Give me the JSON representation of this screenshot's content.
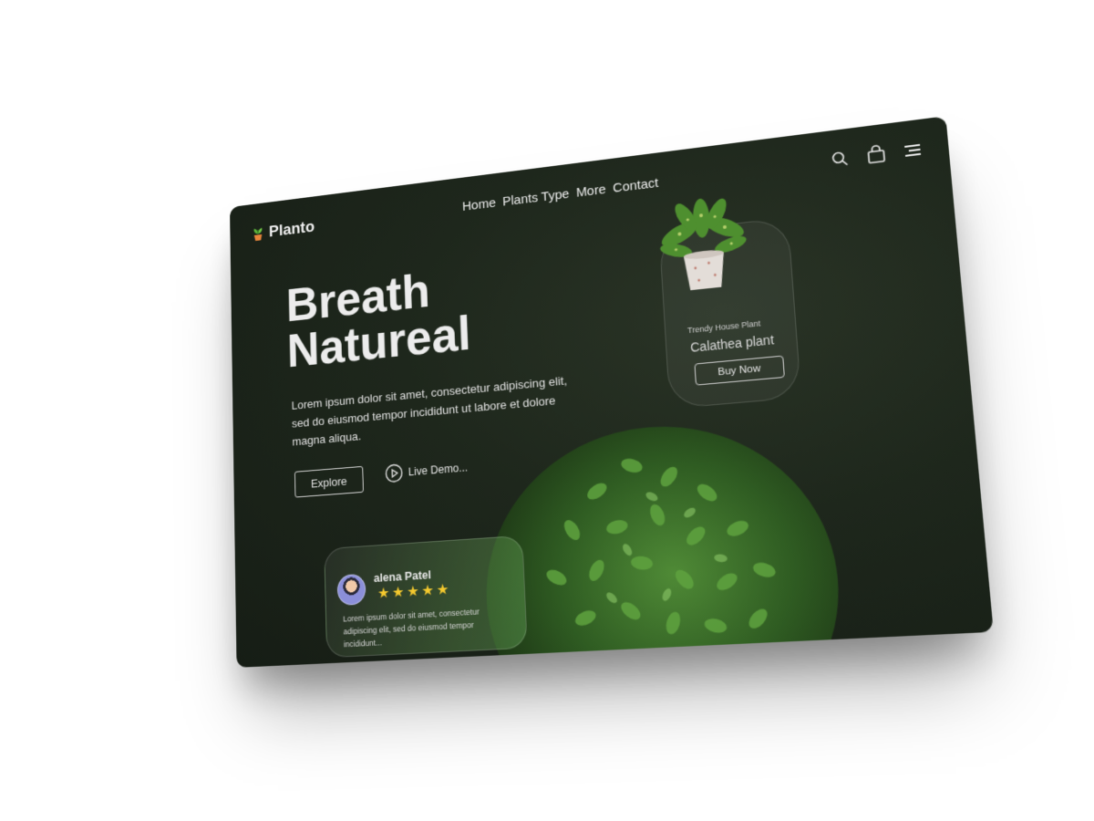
{
  "brand": {
    "name": "Planto",
    "icon": "potted-plant-icon"
  },
  "nav": {
    "items": [
      "Home",
      "Plants Type",
      "More",
      "Contact"
    ],
    "icons": [
      "search-icon",
      "shopping-bag-icon",
      "menu-icon"
    ]
  },
  "hero": {
    "title_line1": "Breath",
    "title_line2": "Natureal",
    "description": "Lorem ipsum dolor sit amet, consectetur adipiscing elit, sed do eiusmod tempor incididunt ut labore et dolore magna aliqua.",
    "explore_label": "Explore",
    "demo_label": "Live Demo...",
    "demo_icon": "play-circle-icon"
  },
  "product": {
    "subtitle": "Trendy House Plant",
    "name": "Calathea plant",
    "buy_label": "Buy Now"
  },
  "review": {
    "name": "alena Patel",
    "rating": 5,
    "text": "Lorem ipsum dolor sit amet, consectetur adipiscing elit, sed do eiusmod tempor incididunt..."
  },
  "colors": {
    "background": "#1e271c",
    "star": "#f4c92e",
    "text": "#f0f0f0"
  }
}
